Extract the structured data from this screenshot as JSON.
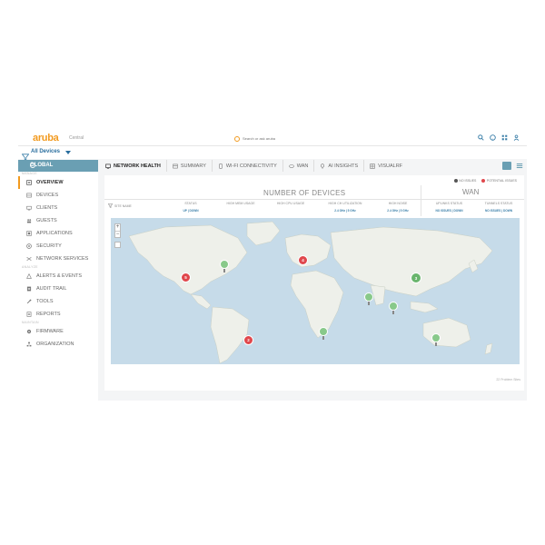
{
  "app": {
    "logo": "aruba",
    "logo_sub": "Central"
  },
  "search": {
    "placeholder": "Search or ask aruba"
  },
  "filter": {
    "label": "All Devices"
  },
  "global": {
    "label": "GLOBAL"
  },
  "sidebar": {
    "sections": [
      "MANAGE",
      "ANALYZE",
      "MAINTAIN"
    ],
    "manage": [
      {
        "label": "OVERVIEW",
        "icon": "overview-icon"
      },
      {
        "label": "DEVICES",
        "icon": "devices-icon"
      },
      {
        "label": "CLIENTS",
        "icon": "clients-icon"
      },
      {
        "label": "GUESTS",
        "icon": "guests-icon"
      },
      {
        "label": "APPLICATIONS",
        "icon": "applications-icon"
      },
      {
        "label": "SECURITY",
        "icon": "security-icon"
      },
      {
        "label": "NETWORK SERVICES",
        "icon": "network-services-icon"
      }
    ],
    "analyze": [
      {
        "label": "ALERTS & EVENTS",
        "icon": "alert-icon"
      },
      {
        "label": "AUDIT TRAIL",
        "icon": "audit-icon"
      },
      {
        "label": "TOOLS",
        "icon": "tools-icon"
      },
      {
        "label": "REPORTS",
        "icon": "reports-icon"
      }
    ],
    "maintain": [
      {
        "label": "FIRMWARE",
        "icon": "firmware-icon"
      },
      {
        "label": "ORGANIZATION",
        "icon": "organization-icon"
      }
    ]
  },
  "tabs": [
    "NETWORK HEALTH",
    "SUMMARY",
    "WI-FI CONNECTIVITY",
    "WAN",
    "AI INSIGHTS",
    "VISUALRF"
  ],
  "legend": {
    "no_issues": "NO ISSUES",
    "potential_issues": "POTENTIAL ISSUES"
  },
  "headers": {
    "number_of_devices": "NUMBER OF DEVICES",
    "wan": "WAN"
  },
  "columns": [
    {
      "label": "SITE NAME"
    },
    {
      "label": "STATUS",
      "value": "UP | DOWN"
    },
    {
      "label": "HIGH MEM USAGE",
      "value": ""
    },
    {
      "label": "HIGH CPU USAGE",
      "value": ""
    },
    {
      "label": "HIGH CH UTILIZATION",
      "value": "2.4 GHz | 5 GHz"
    },
    {
      "label": "HIGH NOISE",
      "value": "2.4 GHz | 5 GHz"
    },
    {
      "label": "UPLINKS STATUS",
      "value": "NO ISSUES | DOWN"
    },
    {
      "label": "TUNNELS STATUS",
      "value": "NO ISSUES | DOWN"
    }
  ],
  "markers": [
    {
      "label": "5",
      "status": "potential_issues"
    },
    {
      "label": "4",
      "status": "potential_issues"
    },
    {
      "label": "2",
      "status": "potential_issues"
    },
    {
      "label": "3",
      "status": "no_issues"
    }
  ],
  "footer": "22 Problem Sites",
  "colors": {
    "accent": "#f29a1f",
    "header": "#6a9fb3",
    "red": "#e0474c",
    "green": "#88c98a",
    "ocean": "#c6dbe9",
    "land": "#eef0ea"
  }
}
